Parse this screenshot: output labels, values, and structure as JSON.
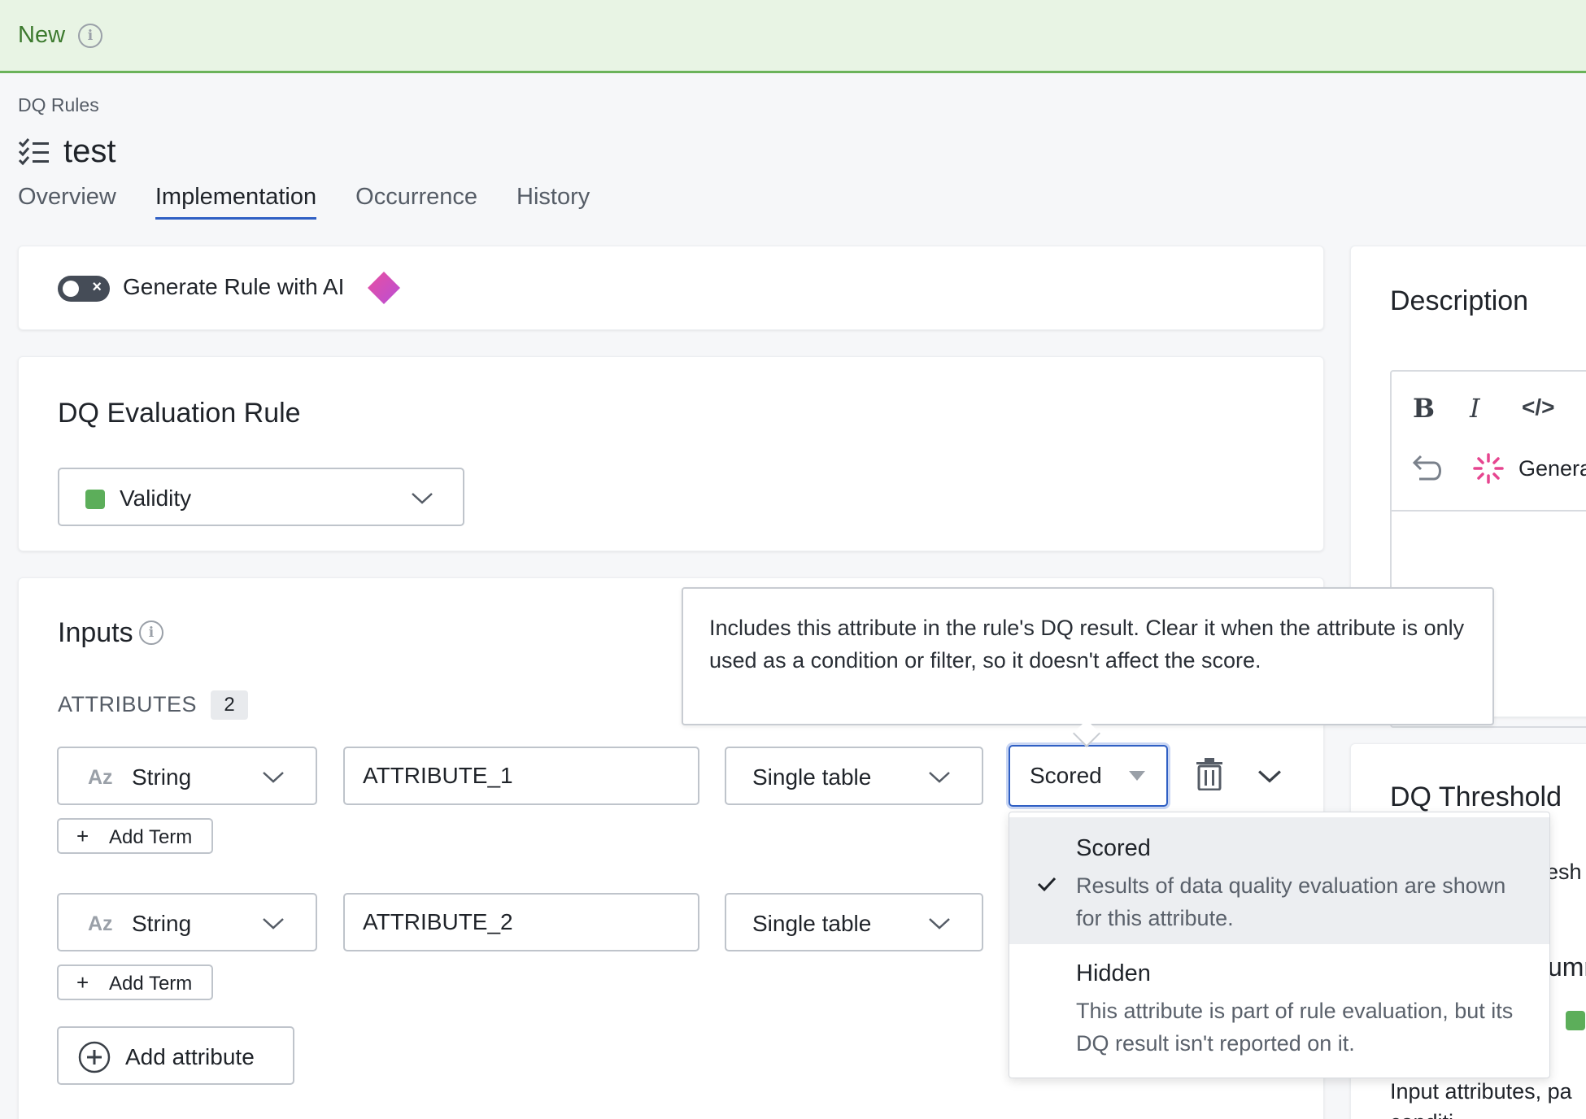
{
  "banner": {
    "label": "New"
  },
  "breadcrumb": "DQ Rules",
  "page": {
    "title": "test"
  },
  "tabs": [
    {
      "label": "Overview"
    },
    {
      "label": "Implementation",
      "active": true
    },
    {
      "label": "Occurrence"
    },
    {
      "label": "History"
    }
  ],
  "ai_card": {
    "toggle_label": "Generate Rule with AI"
  },
  "evaluation": {
    "title": "DQ Evaluation Rule",
    "selected": "Validity",
    "selected_color": "#5cae5a"
  },
  "inputs": {
    "title": "Inputs",
    "attributes_label": "ATTRIBUTES",
    "attributes_count": "2",
    "rows": [
      {
        "type_icon": "Az",
        "type": "String",
        "name": "ATTRIBUTE_1",
        "source": "Single table",
        "add_term": "Add Term"
      },
      {
        "type_icon": "Az",
        "type": "String",
        "name": "ATTRIBUTE_2",
        "source": "Single table",
        "add_term": "Add Term"
      }
    ],
    "scoring_value": "Scored",
    "add_attribute": "Add attribute"
  },
  "tooltip": {
    "text": "Includes this attribute in the rule's DQ result. Clear it when the attribute is only used as a condition or filter, so it doesn't affect the score."
  },
  "scoring_dropdown": {
    "options": [
      {
        "title": "Scored",
        "description": "Results of data quality evaluation are shown for this attribute.",
        "selected": true
      },
      {
        "title": "Hidden",
        "description": "This attribute is part of rule evaluation, but its DQ result isn't reported on it.",
        "selected": false
      }
    ]
  },
  "description_panel": {
    "title": "Description",
    "toolbar": {
      "bold": "B",
      "italic": "I",
      "code": "</>",
      "generate": "Genera"
    }
  },
  "threshold_panel": {
    "title": "DQ Threshold",
    "partial_1": "esh",
    "partial_2": "umr",
    "footer_text": "Input attributes, pa",
    "footer_text_2": "conditi"
  }
}
